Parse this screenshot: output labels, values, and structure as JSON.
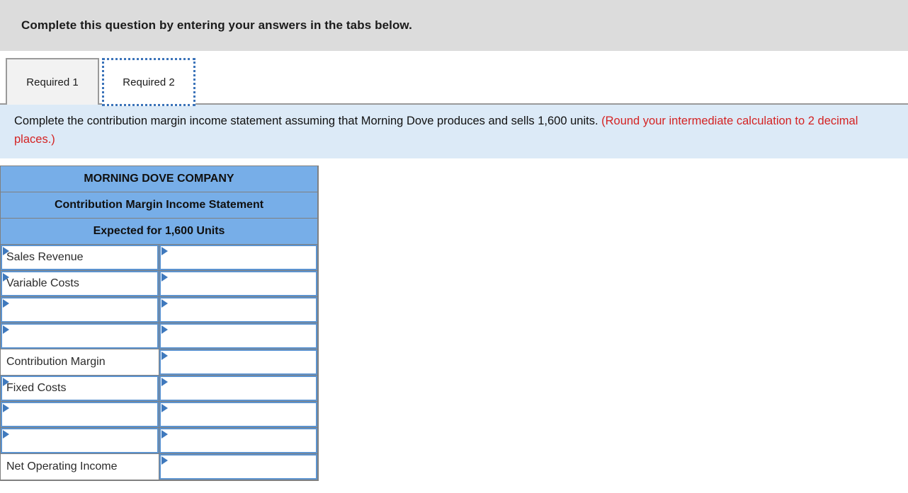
{
  "question_bar": {
    "text": "Complete this question by entering your answers in the tabs below."
  },
  "tabs": [
    {
      "label": "Required 1",
      "active": false
    },
    {
      "label": "Required 2",
      "active": true
    }
  ],
  "requirement": {
    "text": "Complete the contribution margin income statement assuming that Morning Dove produces and sells 1,600 units. ",
    "note": "(Round your intermediate calculation to 2 decimal places.)"
  },
  "statement": {
    "title_lines": [
      "MORNING DOVE COMPANY",
      "Contribution Margin Income Statement",
      "Expected for 1,600 Units"
    ],
    "header_color": "#77aee8",
    "rows": [
      {
        "label": "Sales Revenue",
        "label_editable": true,
        "value": "",
        "value_editable": true,
        "value_rule": "none"
      },
      {
        "label": "Variable Costs",
        "label_editable": true,
        "value": "",
        "value_editable": true,
        "value_rule": "none"
      },
      {
        "label": "",
        "label_editable": true,
        "value": "",
        "value_editable": true,
        "value_rule": "none"
      },
      {
        "label": "",
        "label_editable": true,
        "value": "",
        "value_editable": true,
        "value_rule": "bottom"
      },
      {
        "label": "Contribution Margin",
        "label_editable": false,
        "value": "",
        "value_editable": true,
        "value_rule": "top"
      },
      {
        "label": "Fixed Costs",
        "label_editable": true,
        "value": "",
        "value_editable": true,
        "value_rule": "none"
      },
      {
        "label": "",
        "label_editable": true,
        "value": "",
        "value_editable": true,
        "value_rule": "none"
      },
      {
        "label": "",
        "label_editable": true,
        "value": "",
        "value_editable": true,
        "value_rule": "none"
      },
      {
        "label": "Net Operating Income",
        "label_editable": false,
        "value": "",
        "value_editable": true,
        "value_rule": "top-bottom"
      }
    ]
  }
}
